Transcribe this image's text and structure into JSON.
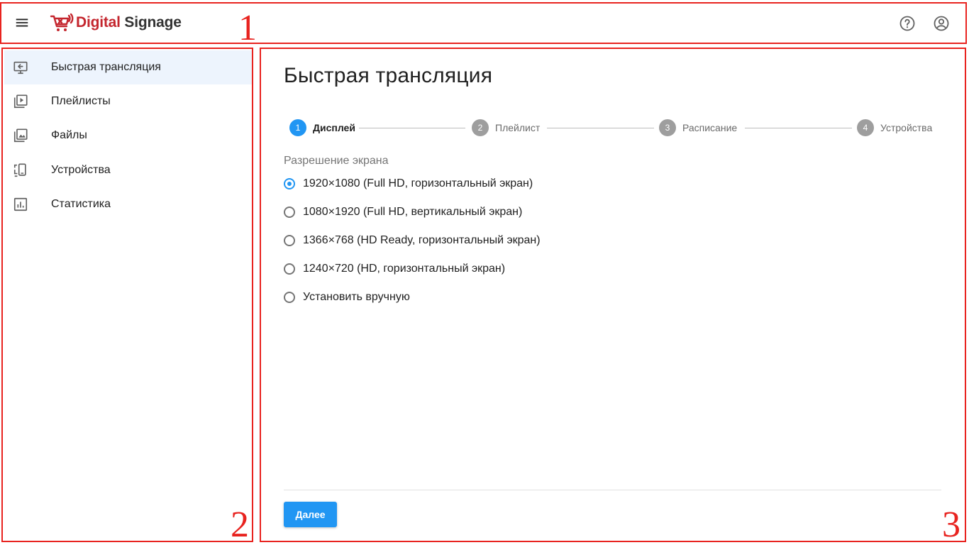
{
  "header": {
    "menu_icon": "hamburger-menu-icon",
    "logo": {
      "word1": "Digital",
      "word2": "Signage",
      "icon": "signage-cart-logo-icon"
    },
    "help_icon": "help-circle-icon",
    "account_icon": "account-circle-icon"
  },
  "sidebar": {
    "items": [
      {
        "label": "Быстрая трансляция",
        "icon": "cast-screen-icon",
        "active": true
      },
      {
        "label": "Плейлисты",
        "icon": "playlist-play-icon",
        "active": false
      },
      {
        "label": "Файлы",
        "icon": "image-library-icon",
        "active": false
      },
      {
        "label": "Устройства",
        "icon": "devices-icon",
        "active": false
      },
      {
        "label": "Статистика",
        "icon": "bar-chart-icon",
        "active": false
      }
    ]
  },
  "main": {
    "title": "Быстрая трансляция",
    "steps": [
      {
        "number": "1",
        "label": "Дисплей",
        "active": true
      },
      {
        "number": "2",
        "label": "Плейлист",
        "active": false
      },
      {
        "number": "3",
        "label": "Расписание",
        "active": false
      },
      {
        "number": "4",
        "label": "Устройства",
        "active": false
      }
    ],
    "resolution": {
      "label": "Разрешение экрана",
      "options": [
        {
          "label": "1920×1080 (Full HD, горизонтальный экран)",
          "selected": true
        },
        {
          "label": "1080×1920 (Full HD, вертикальный экран)",
          "selected": false
        },
        {
          "label": "1366×768 (HD Ready, горизонтальный экран)",
          "selected": false
        },
        {
          "label": "1240×720 (HD, горизонтальный экран)",
          "selected": false
        },
        {
          "label": "Установить вручную",
          "selected": false
        }
      ]
    },
    "next_button": "Далее"
  },
  "annotations": {
    "header": "1",
    "sidebar": "2",
    "main": "3"
  },
  "colors": {
    "accent": "#2196f3",
    "brand_red": "#c4262e",
    "annotation_red": "#e8231f",
    "active_nav_bg": "#edf4fd"
  }
}
